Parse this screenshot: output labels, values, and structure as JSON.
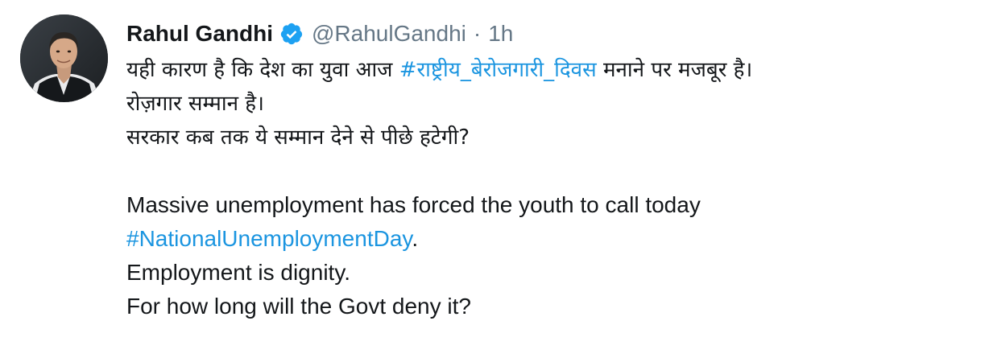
{
  "tweet": {
    "author": {
      "display_name": "Rahul Gandhi",
      "handle": "@RahulGandhi",
      "separator": "·",
      "time": "1h",
      "verified_icon": "verified-badge-icon",
      "avatar_icon": "profile-photo"
    },
    "hindi": {
      "line1_before": "यही कारण है कि देश का युवा आज ",
      "line1_hashtag": "#राष्ट्रीय_बेरोजगारी_दिवस",
      "line1_after": " मनाने पर मजबूर है।",
      "line2": "रोज़गार सम्मान है।",
      "line3": "सरकार कब तक ये सम्मान देने से पीछे हटेगी?"
    },
    "english": {
      "line1": "Massive unemployment has forced the youth to call today",
      "line2_hashtag": "#NationalUnemploymentDay",
      "line2_after": ".",
      "line3": "Employment is dignity.",
      "line4": "For how long will the Govt deny it?"
    },
    "colors": {
      "hashtag": "#1b95e0",
      "verified": "#1da1f2",
      "muted": "#657786",
      "text": "#14171a"
    }
  }
}
